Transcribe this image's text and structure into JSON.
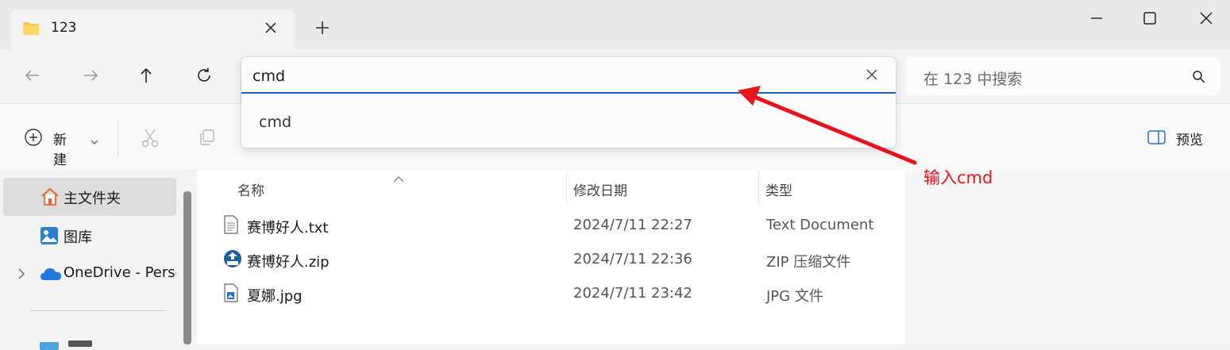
{
  "window": {
    "tab_title": "123",
    "new_tab_label": "+"
  },
  "search": {
    "placeholder": "在 123 中搜索"
  },
  "address_bar": {
    "value": "cmd",
    "suggestions": [
      "cmd"
    ]
  },
  "toolbar": {
    "new_label": "新建",
    "preview_label": "预览"
  },
  "sidebar": {
    "items": [
      {
        "label": "主文件夹",
        "icon": "home-icon"
      },
      {
        "label": "图库",
        "icon": "gallery-icon"
      },
      {
        "label": "OneDrive - Perso",
        "icon": "onedrive-icon"
      }
    ]
  },
  "file_list": {
    "columns": [
      "名称",
      "修改日期",
      "类型"
    ],
    "rows": [
      {
        "name": "赛博好人.txt",
        "modified": "2024/7/11 22:27",
        "type": "Text Document",
        "icon": "text-file-icon"
      },
      {
        "name": "赛博好人.zip",
        "modified": "2024/7/11 22:36",
        "type": "ZIP 压缩文件",
        "icon": "zip-file-icon"
      },
      {
        "name": "夏娜.jpg",
        "modified": "2024/7/11 23:42",
        "type": "JPG 文件",
        "icon": "image-file-icon"
      }
    ]
  },
  "annotation": {
    "text": "输入cmd",
    "color": "#e8141b"
  },
  "colors": {
    "accent": "#1c63b8",
    "folder": "#f7c948"
  }
}
